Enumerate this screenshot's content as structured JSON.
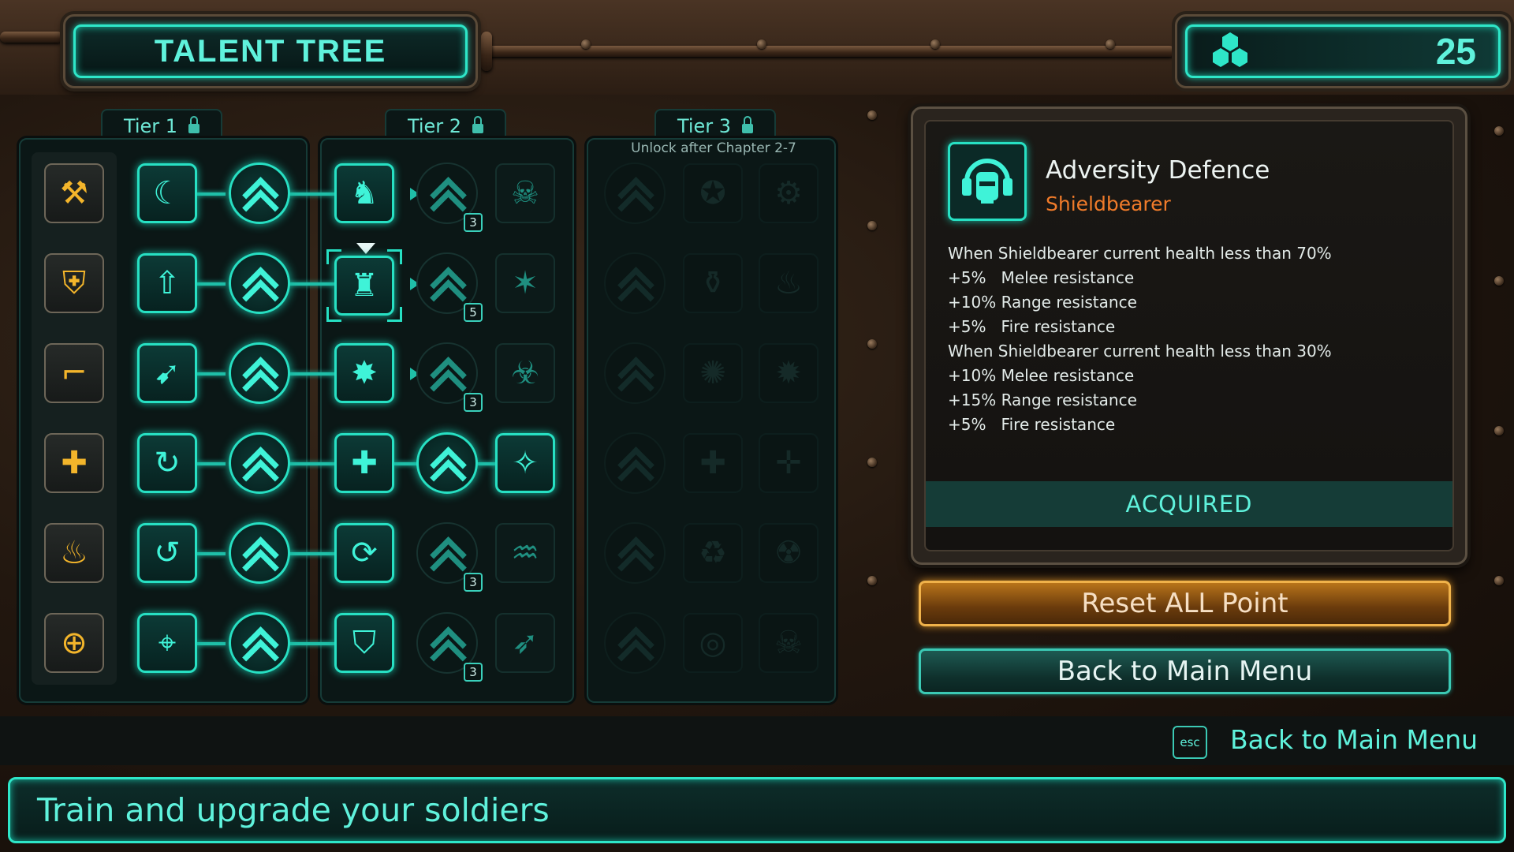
{
  "header": {
    "title": "TALENT TREE",
    "points_value": "25",
    "points_icon": "hexagon-cluster-icon"
  },
  "tiers": [
    {
      "label": "Tier 1",
      "locked_icon": "lock-icon"
    },
    {
      "label": "Tier 2",
      "locked_icon": "lock-icon"
    },
    {
      "label": "Tier 3",
      "locked_icon": "lock-icon",
      "note": "Unlock after Chapter 2-7"
    }
  ],
  "ranks": {
    "row1": "3",
    "row2": "5",
    "row3": "3",
    "row5": "3",
    "row6": "3"
  },
  "detail": {
    "name": "Adversity Defence",
    "class": "Shieldbearer",
    "lines": [
      "When Shieldbearer current health less than 70%",
      "+5%   Melee resistance",
      "+10% Range resistance",
      "+5%   Fire resistance",
      "When Shieldbearer current health less than 30%",
      "+10% Melee resistance",
      "+15% Range resistance",
      "+5%   Fire resistance"
    ],
    "status": "ACQUIRED",
    "status_color": "#5ff2dc",
    "class_color": "#f07b2a"
  },
  "buttons": {
    "reset": "Reset ALL Point",
    "back": "Back to Main Menu"
  },
  "hint": {
    "key": "esc",
    "label": "Back to Main Menu"
  },
  "footer": {
    "text": "Train and upgrade your soldiers"
  },
  "colors": {
    "accent": "#27e0c3",
    "category_icon": "#f3b52b",
    "reset_button": "#f0b24a"
  }
}
